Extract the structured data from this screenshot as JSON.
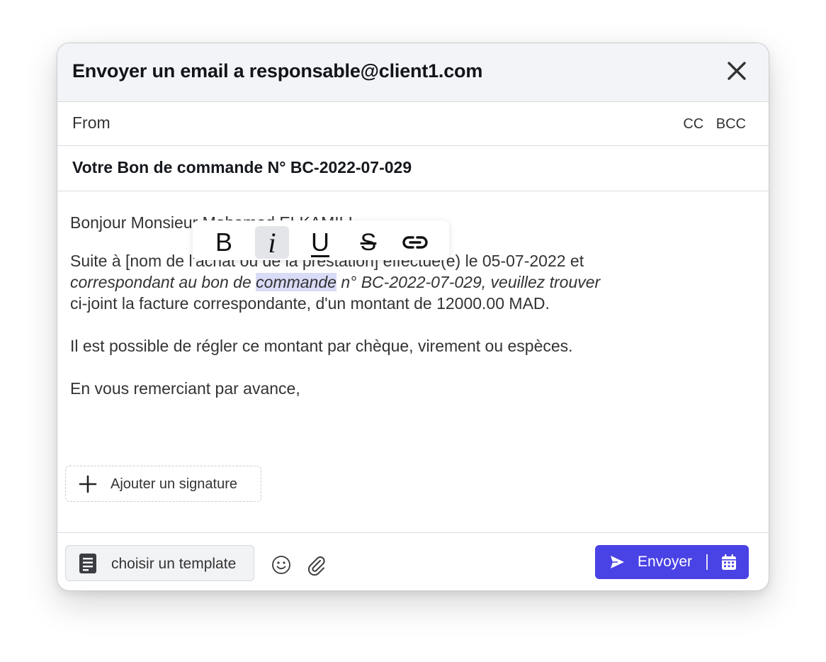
{
  "header": {
    "title": "Envoyer un email a responsable@client1.com",
    "close_icon": "close-icon"
  },
  "from": {
    "label": "From",
    "cc_label": "CC",
    "bcc_label": "BCC"
  },
  "subject": "Votre Bon de commande N° BC-2022-07-029",
  "body": {
    "greeting": "Bonjour Monsieur Mohamed ELKAMILI,",
    "line1": "Suite à [nom de l'achat ou de la prestation] effectué(e) le 05-07-2022 et",
    "line2_pre": "correspondant au bon de ",
    "line2_selected": "commande",
    "line2_post": " n° BC-2022-07-029, veuillez trouver",
    "line3": "ci-joint la facture correspondante, d'un montant de 12000.00 MAD.",
    "line4": "Il est possible de régler ce montant par chèque, virement ou espèces.",
    "line5": "En vous remerciant par avance,"
  },
  "format_toolbar": {
    "bold": "B",
    "italic": "i",
    "underline": "U",
    "strike": "S",
    "link_icon": "link-icon",
    "active": "italic"
  },
  "signature": {
    "label": "Ajouter un signature",
    "icon": "plus-icon"
  },
  "footer": {
    "template_label": "choisir un template",
    "template_icon": "document-icon",
    "emoji_icon": "smiley-icon",
    "attach_icon": "paperclip-icon",
    "send_label": "Envoyer",
    "send_icon": "send-icon",
    "schedule_icon": "calendar-icon"
  },
  "colors": {
    "accent": "#4942e4",
    "header_bg": "#f3f4f7",
    "selection": "#d9dcf7"
  }
}
